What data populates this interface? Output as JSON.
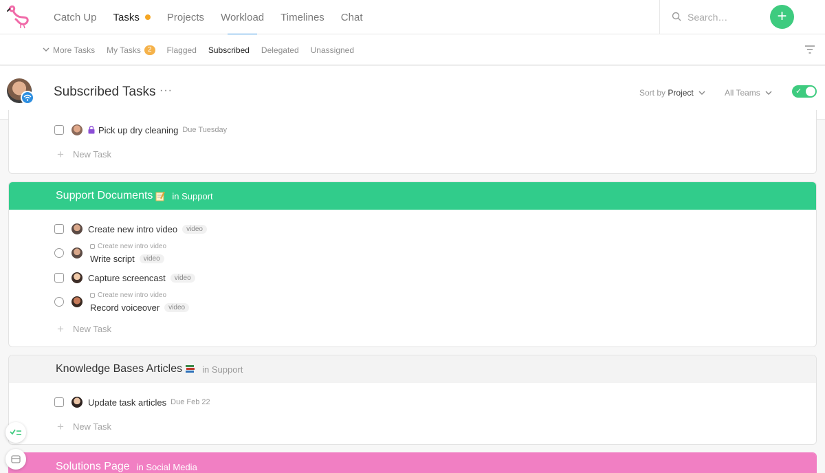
{
  "nav": {
    "tabs": [
      {
        "label": "Catch Up"
      },
      {
        "label": "Tasks"
      },
      {
        "label": "Projects"
      },
      {
        "label": "Workload"
      },
      {
        "label": "Timelines"
      },
      {
        "label": "Chat"
      }
    ],
    "search_placeholder": "Search…",
    "add_label": "+"
  },
  "subnav": {
    "more_tasks": "More Tasks",
    "my_tasks": "My Tasks",
    "my_tasks_count": "2",
    "flagged": "Flagged",
    "subscribed": "Subscribed",
    "delegated": "Delegated",
    "unassigned": "Unassigned"
  },
  "header": {
    "title": "Subscribed Tasks",
    "more": "···",
    "sort_prefix": "Sort by",
    "sort_value": "Project",
    "teams": "All Teams"
  },
  "colors": {
    "accent_green": "#3ecb7f",
    "support_documents": "#31cc8b",
    "solutions_page": "#f17fc3",
    "badge": "#f5b24a"
  },
  "first_card": {
    "task": "Pick up dry cleaning",
    "due": "Due Tuesday",
    "new_task": "New Task"
  },
  "support_documents": {
    "title": "Support Documents",
    "context": "in Support",
    "tasks": [
      {
        "name": "Create new intro video",
        "tag": "video"
      },
      {
        "parent": "Create new intro video",
        "name": "Write script",
        "tag": "video"
      },
      {
        "name": "Capture screencast",
        "tag": "video"
      },
      {
        "parent": "Create new intro video",
        "name": "Record voiceover",
        "tag": "video"
      }
    ],
    "new_task": "New Task"
  },
  "knowledge_bases": {
    "title": "Knowledge Bases Articles",
    "context": "in Support",
    "task": "Update task articles",
    "due": "Due Feb 22",
    "new_task": "New Task"
  },
  "solutions_page": {
    "title": "Solutions Page",
    "context": "in Social Media"
  }
}
